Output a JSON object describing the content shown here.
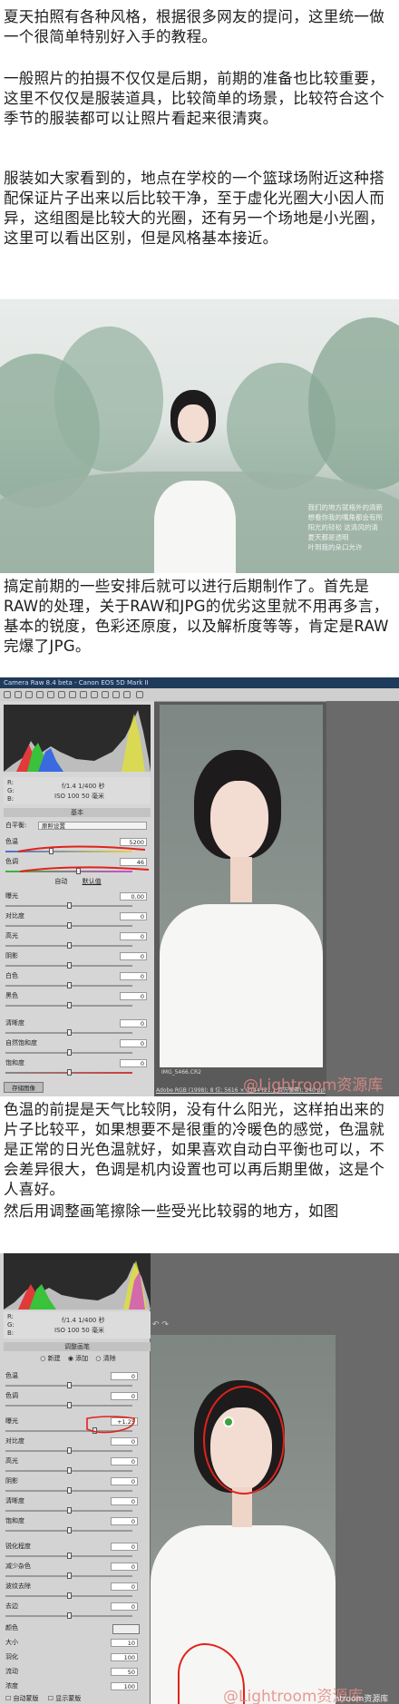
{
  "text_blocks": {
    "p1": "夏天拍照有各种风格，根据很多网友的提问，这里统一做一个很简单特别好入手的教程。",
    "p2": "一般照片的拍摄不仅仅是后期，前期的准备也比较重要，这里不仅仅是服装道具，比较简单的场景，比较符合这个季节的服装都可以让照片看起来很清爽。",
    "p3": "服装如大家看到的，地点在学校的一个篮球场附近这种搭配保证片子出来以后比较干净，至于虚化光圈大小因人而异，这组图是比较大的光圈，还有另一个场地是小光圈，这里可以看出区别，但是风格基本接近。",
    "p4": "搞定前期的一些安排后就可以进行后期制作了。首先是RAW的处理，关于RAW和JPG的优劣这里就不用再多言，基本的锐度，色彩还原度，以及解析度等等，肯定是RAW完爆了JPG。",
    "p5": "色温的前提是天气比较阴，没有什么阳光，这样拍出来的片子比较平，如果想要不是很重的冷暖色的感觉，色温就是正常的日光色温就好，如果喜欢自动白平衡也可以，不会差异很大，色调是机内设置也可以再后期里做，这是个人喜好。",
    "p6": "然后用调整画笔擦除一些受光比较弱的地方，如图"
  },
  "photo1": {
    "poem": [
      "我们的地方就格外的清新",
      "想看你我的嘴角都会有所",
      "阳光的轻松 这清风的清",
      "夏天都是透明",
      "叶到我的朵口允许"
    ]
  },
  "camera_raw": {
    "window_title": "Camera Raw 8.4 beta - Canon EOS 5D Mark II",
    "exif": {
      "aperture": "f/1.4",
      "shutter": "1/400 秒",
      "iso": "ISO 100",
      "focal": "50 毫米"
    },
    "rgb_labels": [
      "R:",
      "G:",
      "B:"
    ],
    "panel_title": "基本",
    "white_balance_label": "白平衡:",
    "white_balance_value": "原照设置",
    "auto_label": "自动",
    "default_label": "默认值",
    "rows": [
      {
        "label": "色温",
        "value": "5200"
      },
      {
        "label": "色调",
        "value": "46"
      },
      {
        "label": "曝光",
        "value": "0.00"
      },
      {
        "label": "对比度",
        "value": "0"
      },
      {
        "label": "高光",
        "value": "0"
      },
      {
        "label": "阴影",
        "value": "0"
      },
      {
        "label": "白色",
        "value": "0"
      },
      {
        "label": "黑色",
        "value": "0"
      },
      {
        "label": "清晰度",
        "value": "0"
      },
      {
        "label": "自然饱和度",
        "value": "0"
      },
      {
        "label": "饱和度",
        "value": "0"
      }
    ],
    "filename": "IMG_5466.CR2",
    "status_line": "Adobe RGB (1998); 8 位; 5616 × 3744 (21.1 百万像素); 240 ppi",
    "save_label": "存储图像",
    "watermark": "@Lightroom资源库"
  },
  "brush_panel": {
    "exif": {
      "aperture": "f/1.4",
      "shutter": "1/400 秒",
      "iso": "ISO 100",
      "focal": "50 毫米"
    },
    "rgb_labels": [
      "R:",
      "G:",
      "B:"
    ],
    "panel_title": "调整画笔",
    "mode": {
      "new": "新建",
      "add": "添加",
      "erase": "清除"
    },
    "rows": [
      {
        "label": "色温",
        "value": "0"
      },
      {
        "label": "色调",
        "value": "0"
      },
      {
        "label": "曝光",
        "value": "+1.25"
      },
      {
        "label": "对比度",
        "value": "0"
      },
      {
        "label": "高光",
        "value": "0"
      },
      {
        "label": "阴影",
        "value": "0"
      },
      {
        "label": "清晰度",
        "value": "0"
      },
      {
        "label": "饱和度",
        "value": "0"
      },
      {
        "label": "锐化程度",
        "value": "0"
      },
      {
        "label": "减少杂色",
        "value": "0"
      },
      {
        "label": "波纹去除",
        "value": "0"
      },
      {
        "label": "去边",
        "value": "0"
      }
    ],
    "color_label": "颜色",
    "brush_rows": [
      {
        "label": "大小",
        "value": "10"
      },
      {
        "label": "羽化",
        "value": "100"
      },
      {
        "label": "流动",
        "value": "50"
      },
      {
        "label": "浓度",
        "value": "100"
      }
    ],
    "auto_mask": "自动蒙版",
    "show_mask": "显示蒙版",
    "watermark": "@Lightroom资源库",
    "site_watermark": "lightroom资源库"
  }
}
